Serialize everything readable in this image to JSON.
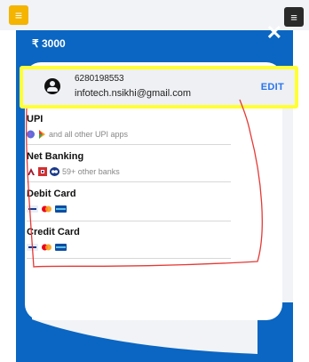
{
  "header": {
    "amount": "₹ 3000",
    "close": "✕",
    "left_menu_icon": "≡",
    "right_menu_icon": "≡"
  },
  "user": {
    "phone": "6280198553",
    "email": "infotech.nsikhi@gmail.com",
    "edit_label": "EDIT"
  },
  "payment_options": [
    {
      "title": "UPI",
      "subtitle": "and all other UPI apps",
      "icons": [
        "phonepe-icon",
        "google-pay-icon"
      ]
    },
    {
      "title": "Net Banking",
      "subtitle": "59+ other banks",
      "icons": [
        "axis-bank-icon",
        "hdfc-bank-icon",
        "icici-bank-icon"
      ]
    },
    {
      "title": "Debit Card",
      "subtitle": "",
      "icons": [
        "visa-icon",
        "mastercard-icon",
        "rupay-icon"
      ]
    },
    {
      "title": "Credit Card",
      "subtitle": "",
      "icons": [
        "visa-icon",
        "mastercard-icon",
        "rupay-icon"
      ]
    }
  ],
  "colors": {
    "brand_blue": "#0a66c2",
    "highlight_yellow": "#ffff33",
    "annotation_red": "#e53935",
    "edit_blue": "#2874f0"
  }
}
